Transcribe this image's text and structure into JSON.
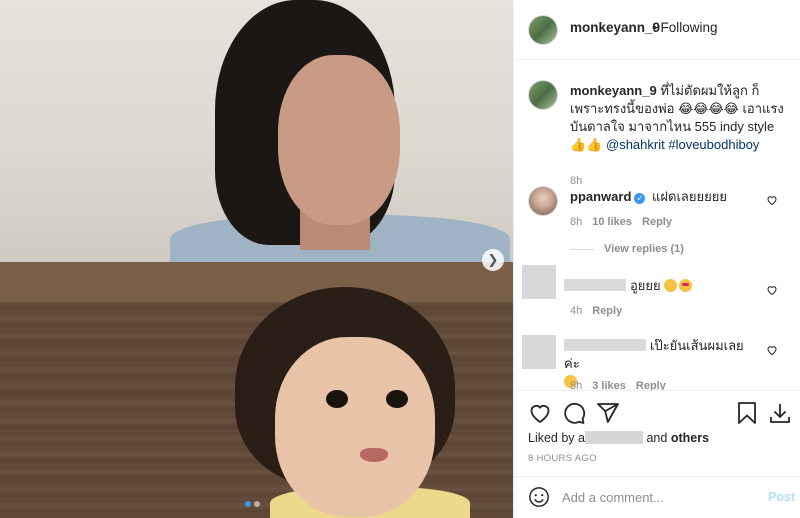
{
  "header": {
    "username": "monkeyann_9",
    "separator": "•",
    "follow_status": "Following"
  },
  "caption": {
    "username": "monkeyann_9",
    "text": "ที่ไม่ตัดผมให้ลูก ก็เพราะทรงนี้ของพ่อ 😂😂😂😂 เอาแรงบันดาลใจ มาจากไหน 555 indy style 👍👍",
    "mention": "@shahkrit",
    "hashtag": "#loveubodhiboy",
    "time": "8h"
  },
  "comments": [
    {
      "username": "ppanward",
      "verified": true,
      "text": "แฝดเลยยยยย",
      "time": "8h",
      "likes": "10 likes",
      "reply_label": "Reply",
      "view_replies": "View replies (1)"
    },
    {
      "username_hidden": true,
      "text": "อูยยย",
      "time": "4h",
      "reply_label": "Reply"
    },
    {
      "username_hidden": true,
      "text": "เป๊ะยันเส้นผมเลยค่ะ",
      "time": "8h",
      "likes": "3 likes",
      "reply_label": "Reply"
    }
  ],
  "actions": {
    "liked_by_prefix": "Liked by",
    "liked_by_partial": "a",
    "liked_by_suffix": "and",
    "others": "others",
    "post_time": "8 HOURS AGO"
  },
  "composer": {
    "placeholder": "Add a comment...",
    "post_label": "Post"
  },
  "carousel": {
    "current_slide": 1,
    "total_slides": 2
  },
  "icons": {
    "like": "heart-icon",
    "comment": "comment-icon",
    "share": "share-icon",
    "save": "bookmark-icon",
    "download": "download-icon",
    "emoji": "smile-icon",
    "next": "chevron-right-icon"
  },
  "colors": {
    "link": "#003569",
    "accent": "#3897f0",
    "muted": "#8e8e8e",
    "post_disabled": "#b2dffc"
  }
}
